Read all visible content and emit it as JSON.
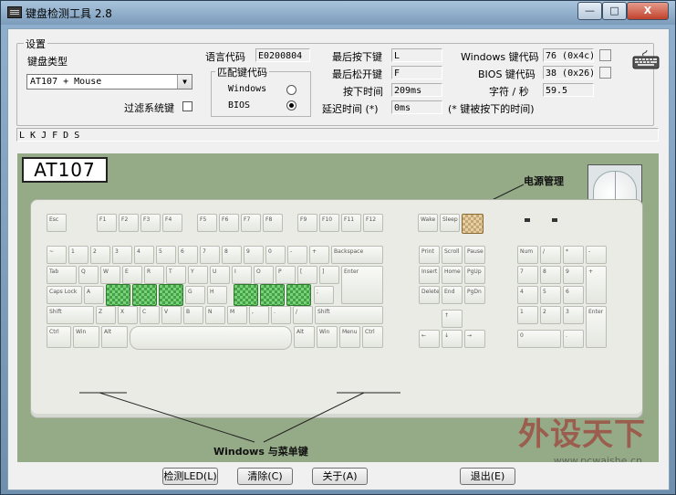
{
  "window": {
    "title": "键盘检测工具 2.8"
  },
  "settings": {
    "group_title": "设置",
    "keyboard_type_label": "键盘类型",
    "keyboard_type_value": "AT107 + Mouse",
    "filter_system_keys_label": "过滤系统键",
    "language_code_label": "语言代码",
    "language_code_value": "E0200804",
    "match_code_group_title": "匹配键代码",
    "match_code_windows": "Windows",
    "match_code_bios": "BIOS",
    "last_pressed_label": "最后按下键",
    "last_pressed_value": "L",
    "last_released_label": "最后松开键",
    "last_released_value": "F",
    "press_time_label": "按下时间",
    "press_time_value": "209ms",
    "delay_time_label": "延迟时间 (*)",
    "delay_time_value": "0ms",
    "windows_keycode_label": "Windows 键代码",
    "windows_keycode_value": "76 (0x4c)",
    "bios_keycode_label": "BIOS 键代码",
    "bios_keycode_value": "38 (0x26)",
    "chars_per_sec_label": "字符 / 秒",
    "chars_per_sec_value": "59.5",
    "note": "(* 键被按下的时间)"
  },
  "log": {
    "text": "L K J F D S"
  },
  "keyboard": {
    "model": "AT107",
    "power_label": "电源管理",
    "win_menu_label": "Windows 与菜单键"
  },
  "watermark": {
    "text": "外设天下",
    "url": "www.pcwaishe.cn"
  },
  "buttons": {
    "detect_led": "检测LED(L)",
    "clear": "清除(C)",
    "about": "关于(A)",
    "exit": "退出(E)"
  },
  "window_controls": {
    "minimize": "—",
    "maximize": "□",
    "close": "X"
  }
}
